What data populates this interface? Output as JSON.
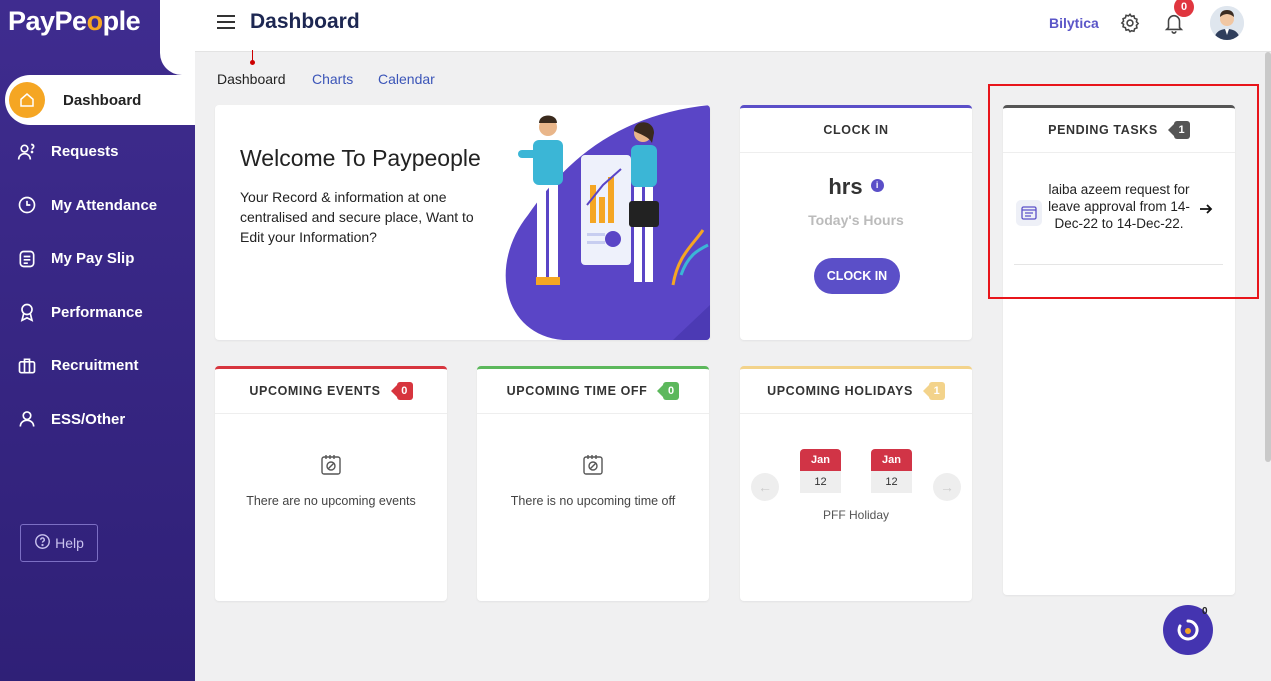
{
  "app": {
    "logo_prefix": "PayPe",
    "logo_o": "o",
    "logo_suffix": "ple"
  },
  "sidebar": {
    "items": [
      {
        "label": "Dashboard",
        "icon": "home-icon",
        "active": true
      },
      {
        "label": "Requests",
        "icon": "requests-icon"
      },
      {
        "label": "My Attendance",
        "icon": "clock-icon"
      },
      {
        "label": "My Pay Slip",
        "icon": "payslip-icon"
      },
      {
        "label": "Performance",
        "icon": "award-icon"
      },
      {
        "label": "Recruitment",
        "icon": "briefcase-icon"
      },
      {
        "label": "ESS/Other",
        "icon": "user-icon"
      }
    ],
    "help_label": "Help"
  },
  "header": {
    "title": "Dashboard",
    "org_name": "Bilytica",
    "notification_count": "0"
  },
  "tabs": [
    "Dashboard",
    "Charts",
    "Calendar"
  ],
  "welcome": {
    "title": "Welcome To Paypeople",
    "text": "Your Record & information at one centralised and secure place, Want to Edit your Information?"
  },
  "clock_in": {
    "header": "CLOCK IN",
    "hours": "hrs",
    "info": "i",
    "label": "Today's Hours",
    "button": "CLOCK IN"
  },
  "pending_tasks": {
    "header": "PENDING TASKS",
    "count": "1",
    "items": [
      {
        "text": "laiba azeem request for leave approval from 14-Dec-22 to 14-Dec-22."
      }
    ]
  },
  "upcoming_events": {
    "header": "UPCOMING EVENTS",
    "count": "0",
    "empty_text": "There are no upcoming events"
  },
  "upcoming_time_off": {
    "header": "UPCOMING TIME OFF",
    "count": "0",
    "empty_text": "There is no upcoming time off"
  },
  "upcoming_holidays": {
    "header": "UPCOMING HOLIDAYS",
    "count": "1",
    "dates": [
      {
        "month": "Jan",
        "day": "12"
      },
      {
        "month": "Jan",
        "day": "12"
      }
    ],
    "holiday_name": "PFF Holiday"
  },
  "fab": {
    "count": "0"
  },
  "colors": {
    "sidebar": "#3f2c8f",
    "accent": "#5b4fc8",
    "active_icon": "#f5a623",
    "events_badge": "#d7353e",
    "time_off_badge": "#5cb85c",
    "holidays_badge": "#f3d38b",
    "highlight_box": "#e8151b"
  }
}
